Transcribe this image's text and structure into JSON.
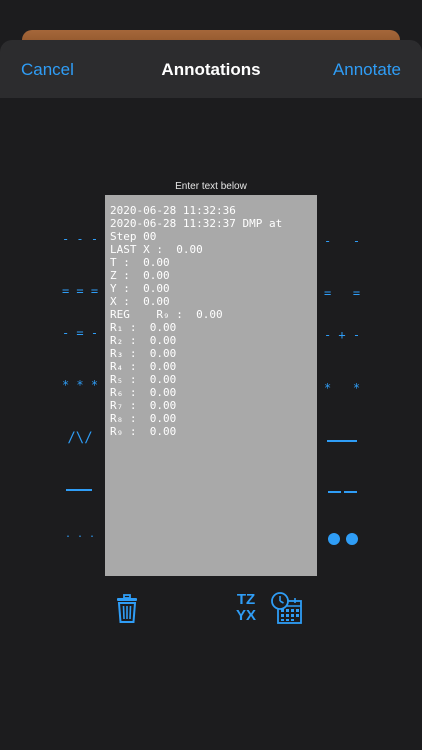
{
  "nav": {
    "cancel_label": "Cancel",
    "title": "Annotations",
    "annotate_label": "Annotate"
  },
  "editor": {
    "prompt": "Enter text below",
    "lines": [
      "2020-06-28 11:32:36",
      "2020-06-28 11:32:37 DMP at",
      "Step 00",
      "LAST X :  0.00",
      "T :  0.00",
      "Z :  0.00",
      "Y :  0.00",
      "X :  0.00",
      "REG    R₉ :  0.00",
      "R₁ :  0.00",
      "R₂ :  0.00",
      "R₃ :  0.00",
      "R₄ :  0.00",
      "R₅ :  0.00",
      "R₆ :  0.00",
      "R₇ :  0.00",
      "R₈ :  0.00",
      "R₉ :  0.00"
    ]
  },
  "left_styles": [
    {
      "name": "dash-triple",
      "glyph": "- - -"
    },
    {
      "name": "equals-triple",
      "glyph": "= = ="
    },
    {
      "name": "dash-equals-dash",
      "glyph": "- = -"
    },
    {
      "name": "asterisk-triple",
      "glyph": "* * *"
    },
    {
      "name": "slash-pattern",
      "glyph": "/\\/"
    },
    {
      "name": "solid-line",
      "glyph": ""
    },
    {
      "name": "dots",
      "glyph": ". . ."
    }
  ],
  "right_styles": [
    {
      "name": "dash-double",
      "glyph": "-   -"
    },
    {
      "name": "equals-double",
      "glyph": "=   ="
    },
    {
      "name": "dash-plus-dash",
      "glyph": "- + -"
    },
    {
      "name": "asterisk-double",
      "glyph": "*   *"
    },
    {
      "name": "solid-line",
      "glyph": ""
    },
    {
      "name": "double-dash-line",
      "glyph": ""
    },
    {
      "name": "large-dots",
      "glyph": ""
    }
  ],
  "toolbar": {
    "tzyx_top": "TZ",
    "tzyx_bottom": "YX",
    "delete_icon": "trash-icon",
    "stack_icon": "tzyx-stack-icon",
    "timestamp_icon": "calendar-clock-icon"
  },
  "colors": {
    "accent": "#2f9df6",
    "background": "#1c1c1e",
    "navbar": "#2c2c2e",
    "text_area": "#a9a9a9"
  }
}
